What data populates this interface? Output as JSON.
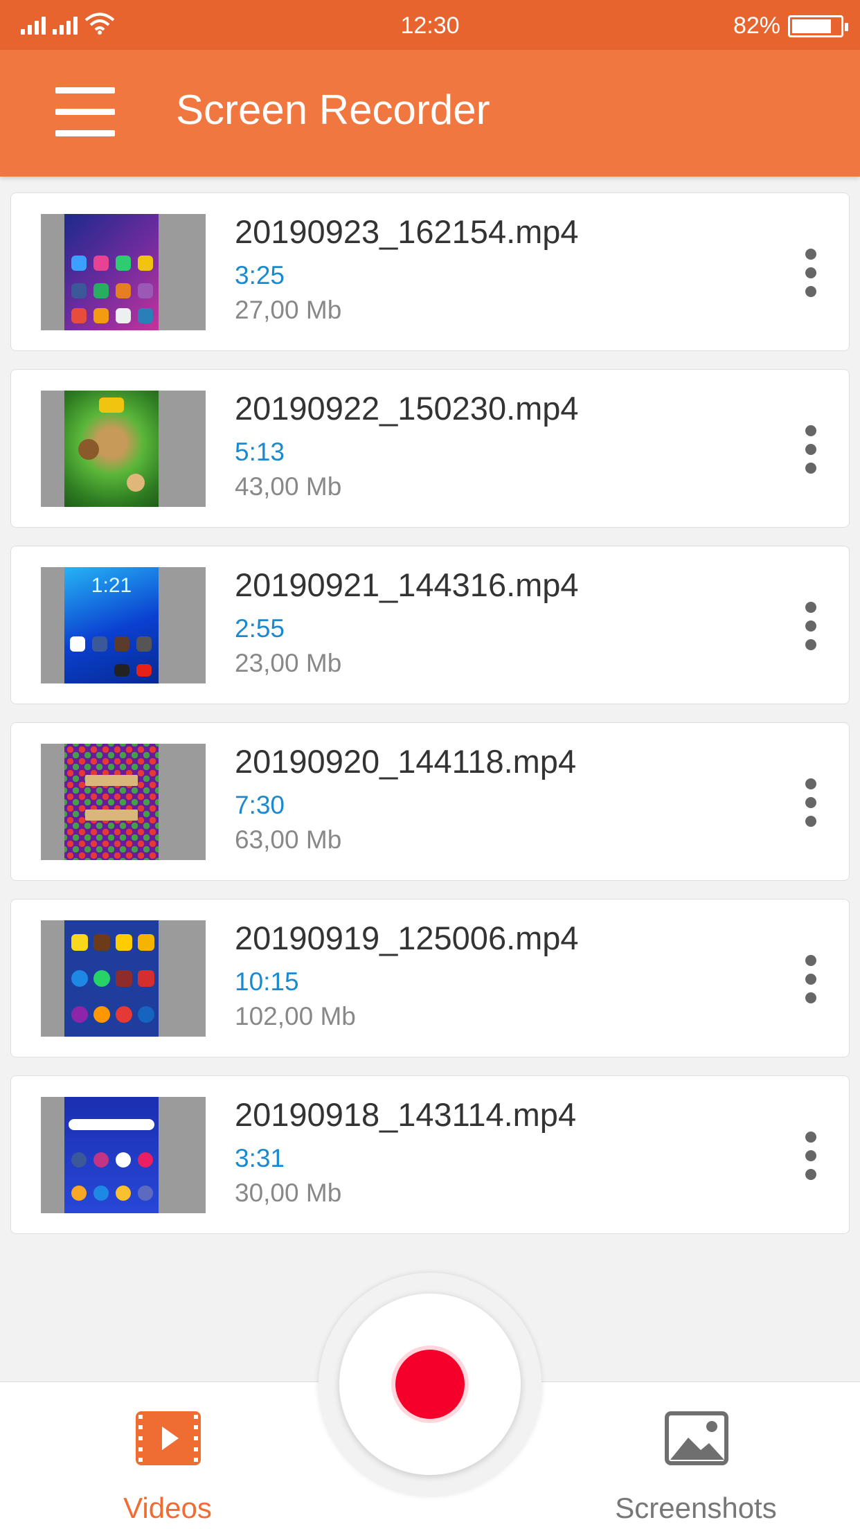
{
  "status_bar": {
    "time": "12:30",
    "battery": "82%"
  },
  "app_bar": {
    "title": "Screen Recorder"
  },
  "colors": {
    "accent": "#f07840",
    "status": "#e8642f",
    "duration": "#1a8ad0",
    "record": "#f5002b"
  },
  "videos": [
    {
      "name": "20190923_162154.mp4",
      "duration": "3:25",
      "size": "27,00 Mb"
    },
    {
      "name": "20190922_150230.mp4",
      "duration": "5:13",
      "size": "43,00 Mb"
    },
    {
      "name": "20190921_144316.mp4",
      "duration": "2:55",
      "size": "23,00 Mb"
    },
    {
      "name": "20190920_144118.mp4",
      "duration": "7:30",
      "size": "63,00 Mb"
    },
    {
      "name": "20190919_125006.mp4",
      "duration": "10:15",
      "size": "102,00 Mb"
    },
    {
      "name": "20190918_143114.mp4",
      "duration": "3:31",
      "size": "30,00 Mb"
    }
  ],
  "bottom_nav": {
    "videos_label": "Videos",
    "screenshots_label": "Screenshots"
  },
  "icons": {
    "menu": "hamburger-menu-icon",
    "more": "more-vertical-icon",
    "videos": "film-play-icon",
    "screenshots": "image-icon",
    "record": "record-icon"
  }
}
